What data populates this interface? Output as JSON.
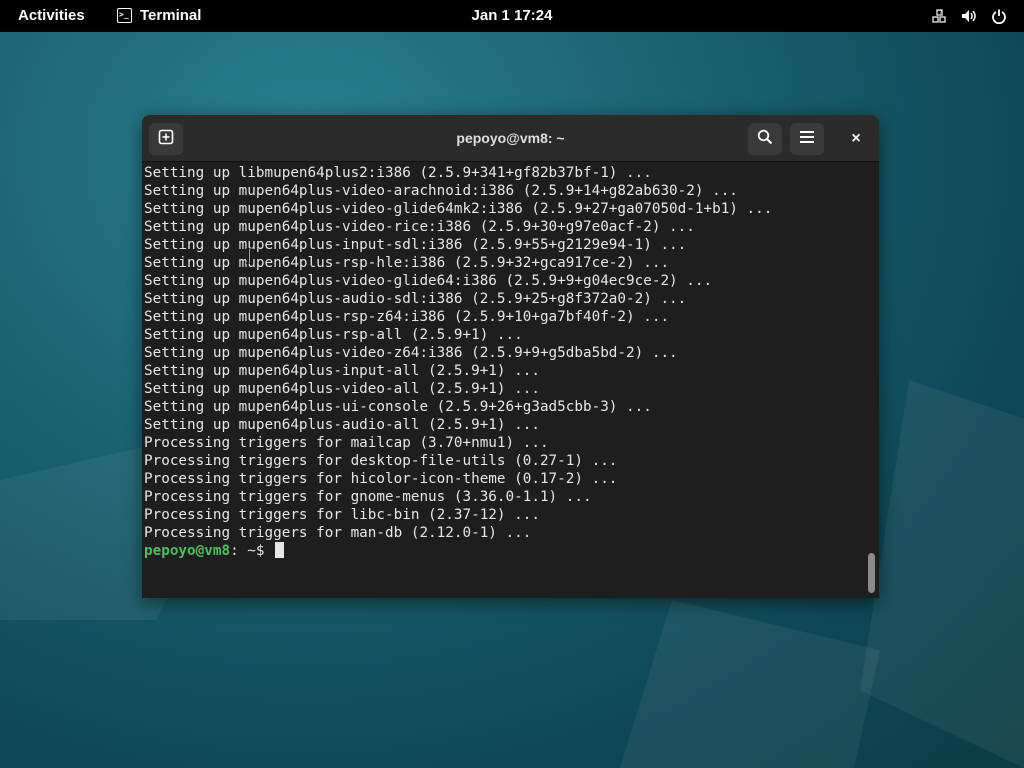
{
  "topbar": {
    "activities": "Activities",
    "app_name": "Terminal",
    "app_icon_glyph": ">_",
    "clock": "Jan 1  17:24",
    "tray_icons": [
      "network-icon",
      "volume-icon",
      "power-icon"
    ]
  },
  "window": {
    "title": "pepoyo@vm8: ~",
    "close_glyph": "×"
  },
  "terminal": {
    "lines": [
      "Setting up libmupen64plus2:i386 (2.5.9+341+gf82b37bf-1) ...",
      "Setting up mupen64plus-video-arachnoid:i386 (2.5.9+14+g82ab630-2) ...",
      "Setting up mupen64plus-video-glide64mk2:i386 (2.5.9+27+ga07050d-1+b1) ...",
      "Setting up mupen64plus-video-rice:i386 (2.5.9+30+g97e0acf-2) ...",
      "Setting up mupen64plus-input-sdl:i386 (2.5.9+55+g2129e94-1) ...",
      "Setting up mupen64plus-rsp-hle:i386 (2.5.9+32+gca917ce-2) ...",
      "Setting up mupen64plus-video-glide64:i386 (2.5.9+9+g04ec9ce-2) ...",
      "Setting up mupen64plus-audio-sdl:i386 (2.5.9+25+g8f372a0-2) ...",
      "Setting up mupen64plus-rsp-z64:i386 (2.5.9+10+ga7bf40f-2) ...",
      "Setting up mupen64plus-rsp-all (2.5.9+1) ...",
      "Setting up mupen64plus-video-z64:i386 (2.5.9+9+g5dba5bd-2) ...",
      "Setting up mupen64plus-input-all (2.5.9+1) ...",
      "Setting up mupen64plus-video-all (2.5.9+1) ...",
      "Setting up mupen64plus-ui-console (2.5.9+26+g3ad5cbb-3) ...",
      "Setting up mupen64plus-audio-all (2.5.9+1) ...",
      "Processing triggers for mailcap (3.70+nmu1) ...",
      "Processing triggers for desktop-file-utils (0.27-1) ...",
      "Processing triggers for hicolor-icon-theme (0.17-2) ...",
      "Processing triggers for gnome-menus (3.36.0-1.1) ...",
      "Processing triggers for libc-bin (2.37-12) ...",
      "Processing triggers for man-db (2.12.0-1) ..."
    ],
    "prompt_user": "pepoyo@vm8",
    "prompt_rest": ": ~$ ",
    "prompt_user_color": "#4fbf5c",
    "background_color": "#1e1e1e"
  }
}
